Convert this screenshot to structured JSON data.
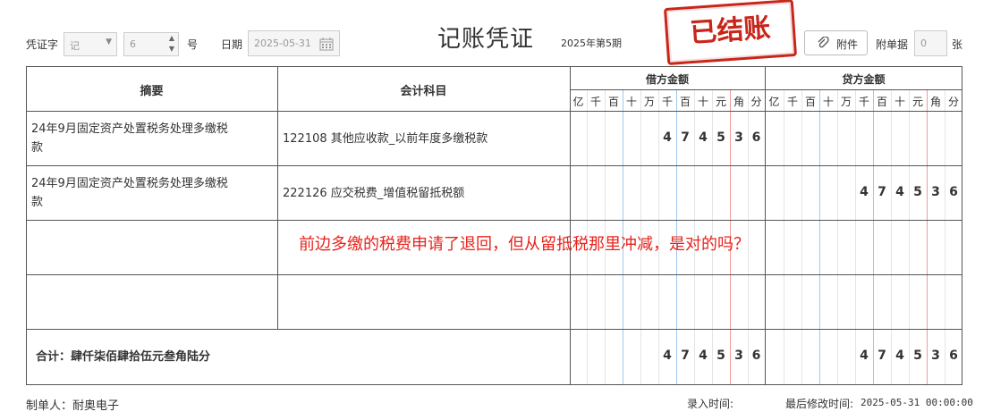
{
  "header": {
    "voucher_word_label": "凭证字",
    "voucher_word_value": "记",
    "voucher_no_value": "6",
    "voucher_no_suffix": "号",
    "date_label": "日期",
    "date_value": "2025-05-31",
    "title": "记账凭证",
    "period": "2025年第5期",
    "stamp": "已结账",
    "attach_button": "附件",
    "attach_count_label": "附单据",
    "attach_count_value": "0",
    "attach_count_suffix": "张"
  },
  "table": {
    "col_summary": "摘要",
    "col_account": "会计科目",
    "col_debit": "借方金额",
    "col_credit": "贷方金额",
    "units": [
      "亿",
      "千",
      "百",
      "十",
      "万",
      "千",
      "百",
      "十",
      "元",
      "角",
      "分"
    ],
    "rows": [
      {
        "summary_line1": "24年9月固定资产处置税务处理多缴税",
        "summary_line2": "款",
        "account": "122108  其他应收款_以前年度多缴税款",
        "debit": [
          "",
          "",
          "",
          "",
          "",
          "4",
          "7",
          "4",
          "5",
          "3",
          "6"
        ],
        "credit": [
          "",
          "",
          "",
          "",
          "",
          "",
          "",
          "",
          "",
          "",
          ""
        ]
      },
      {
        "summary_line1": "24年9月固定资产处置税务处理多缴税",
        "summary_line2": "款",
        "account": "222126  应交税费_增值税留抵税额",
        "debit": [
          "",
          "",
          "",
          "",
          "",
          "",
          "",
          "",
          "",
          "",
          ""
        ],
        "credit": [
          "",
          "",
          "",
          "",
          "",
          "4",
          "7",
          "4",
          "5",
          "3",
          "6"
        ]
      }
    ],
    "annotation": "前边多缴的税费申请了退回，但从留抵税那里冲减，是对的吗？",
    "total_label": "合计：肆仟柒佰肆拾伍元叁角陆分",
    "total_debit": [
      "",
      "",
      "",
      "",
      "",
      "4",
      "7",
      "4",
      "5",
      "3",
      "6"
    ],
    "total_credit": [
      "",
      "",
      "",
      "",
      "",
      "4",
      "7",
      "4",
      "5",
      "3",
      "6"
    ]
  },
  "footer": {
    "maker": "制单人：耐奥电子",
    "entry_time_label": "录入时间:",
    "modified_label": "最后修改时间:",
    "modified_value": "2025-05-31 00:00:00"
  },
  "colors": {
    "stamp": "#c8261b",
    "annotation": "#e8231b",
    "grid_blue": "#9fc9ec",
    "grid_red": "#f19a9a"
  }
}
